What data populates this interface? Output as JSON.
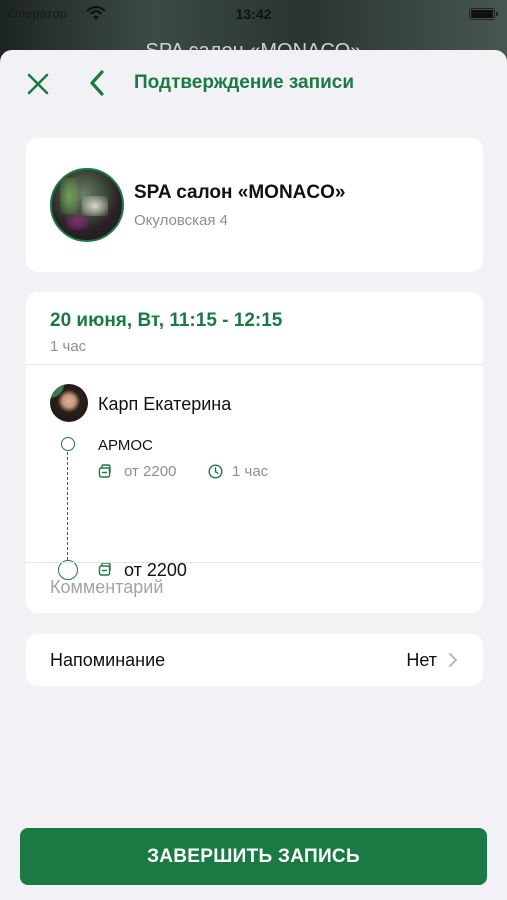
{
  "status_bar": {
    "carrier": "Оператор",
    "time": "13:42"
  },
  "background_title": "SPA салон «MONACO»",
  "nav": {
    "title": "Подтверждение записи"
  },
  "salon": {
    "name": "SPA салон «MONACO»",
    "address": "Окуловская 4"
  },
  "booking": {
    "date_time": "20 июня, Вт, 11:15 - 12:15",
    "duration": "1 час",
    "master_name": "Карп Екатерина",
    "service": {
      "name": "АРМОС",
      "price": "от 2200",
      "time": "1 час"
    },
    "total_price": "от 2200",
    "comment_placeholder": "Комментарий"
  },
  "reminder": {
    "label": "Напоминание",
    "value": "Нет"
  },
  "finish_button": {
    "label": "ЗАВЕРШИТЬ ЗАПИСЬ"
  },
  "colors": {
    "accent": "#1b7a43",
    "background": "#f1f1f6",
    "card": "#ffffff",
    "secondary_text": "#8e8e93"
  },
  "icons": [
    "wifi-icon",
    "battery-icon",
    "close-icon",
    "back-arrow-icon",
    "price-tag-icon",
    "clock-icon",
    "chevron-right-icon"
  ]
}
